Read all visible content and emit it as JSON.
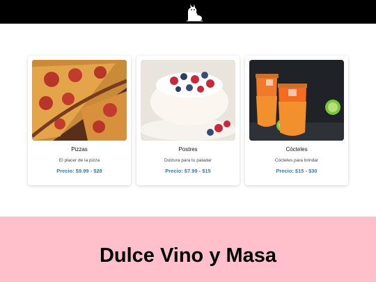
{
  "header": {
    "logo_icon": "cat-logo-icon"
  },
  "products": [
    {
      "title": "Pizzas",
      "description": "El placer de la pizza",
      "price": "Precio: $9.99 - $28",
      "image_icon": "pizza-image"
    },
    {
      "title": "Postres",
      "description": "Dulzura para tu paladar",
      "price": "Precio: $7.99 - $15",
      "image_icon": "dessert-image"
    },
    {
      "title": "Cócteles",
      "description": "Cócteles para brindar",
      "price": "Precio: $15 - $30",
      "image_icon": "cocktail-image"
    }
  ],
  "footer": {
    "brand": "Dulce Vino y Masa",
    "background": "#ffc0cb"
  },
  "colors": {
    "topbar": "#000000",
    "price": "#2a7ec4"
  }
}
